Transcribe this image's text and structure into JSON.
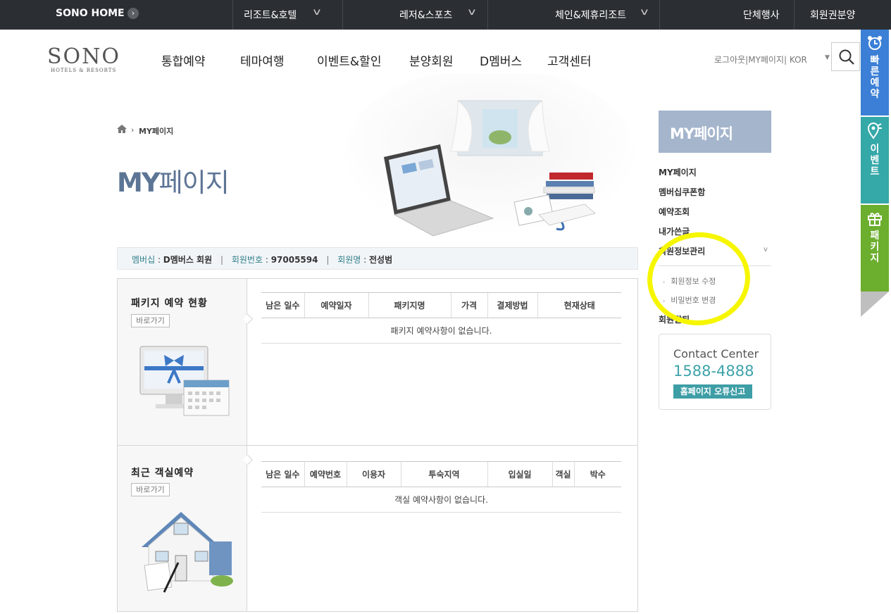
{
  "topnav": {
    "home": "SONO HOME",
    "menu": [
      "리조트&호텔",
      "레저&스포츠",
      "체인&제휴리조트",
      "단체행사",
      "회원권분양"
    ]
  },
  "header": {
    "logo": "SONO",
    "logo_sub": "HOTELS & RESORTS",
    "gnb": [
      "통합예약",
      "테마여행",
      "이벤트&할인",
      "분양회원",
      "D멤버스",
      "고객센터"
    ],
    "utility": "로그아웃|MY페이지|  KOR"
  },
  "page": {
    "breadcrumb": "MY페이지",
    "title_prefix": "MY",
    "title_suffix": "페이지"
  },
  "member": {
    "membership_label": "멤버십",
    "membership_value": "D멤버스 회원",
    "number_label": "회원번호",
    "number_value": "97005594",
    "name_label": "회원명",
    "name_value": "전성범"
  },
  "package_section": {
    "title": "패키지 예약 현황",
    "goto": "바로가기",
    "columns": [
      "남은 일수",
      "예약일자",
      "패키지명",
      "가격",
      "결제방법",
      "현재상태"
    ],
    "empty": "패키지 예약사항이 없습니다."
  },
  "room_section": {
    "title": "최근 객실예약",
    "goto": "바로가기",
    "columns": [
      "남은 일수",
      "예약번호",
      "이용자",
      "투숙지역",
      "입실일",
      "객실",
      "박수"
    ],
    "empty": "객실 예약사항이 없습니다."
  },
  "sidebar": {
    "head": "MY페이지",
    "items": [
      "MY페이지",
      "멤버십쿠폰함",
      "예약조회",
      "내가쓴글",
      "회원정보관리"
    ],
    "sub_items": [
      "회원정보 수정",
      "비밀번호 변경"
    ],
    "last_item": "회원탈퇴"
  },
  "contact": {
    "title": "Contact Center",
    "phone": "1588-4888",
    "report_button": "홈페이지 오류신고"
  },
  "quick_tabs": [
    {
      "label": "빠른예약",
      "color": "#3b7fd6",
      "icon": "alarm-clock-icon"
    },
    {
      "label": "이벤트",
      "color": "#35a8a8",
      "icon": "location-pin-icon"
    },
    {
      "label": "패키지",
      "color": "#6cae2d",
      "icon": "gift-icon"
    }
  ],
  "colors": {
    "accent": "#5d7595",
    "teal": "#3ea3a9",
    "highlight": "#f6f600"
  }
}
